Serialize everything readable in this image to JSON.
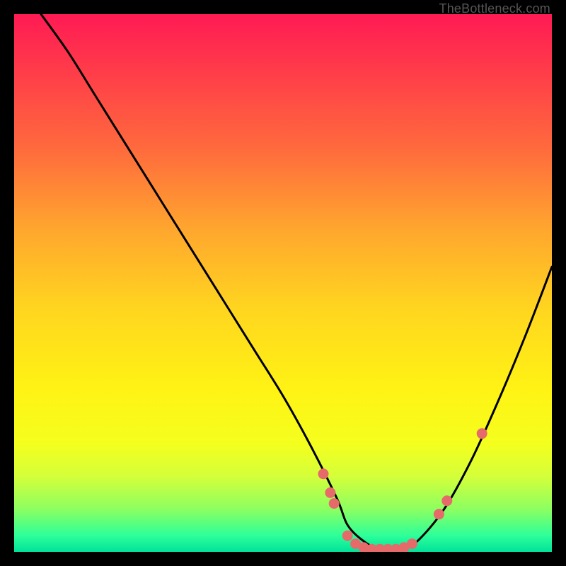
{
  "watermark": "TheBottleneck.com",
  "chart_data": {
    "type": "line",
    "title": "",
    "xlabel": "",
    "ylabel": "",
    "xlim": [
      0,
      100
    ],
    "ylim": [
      0,
      100
    ],
    "grid": false,
    "legend": false,
    "series": [
      {
        "name": "bottleneck-curve",
        "x": [
          5,
          10,
          15,
          20,
          25,
          30,
          35,
          40,
          45,
          50,
          55,
          60,
          62,
          65,
          68,
          72,
          75,
          80,
          85,
          90,
          95,
          100
        ],
        "y": [
          100,
          93,
          85,
          77,
          69,
          61,
          53,
          45,
          37,
          29,
          20,
          10,
          5,
          2,
          0.5,
          0.5,
          2,
          8,
          17,
          28,
          40,
          53
        ],
        "color": "#000000"
      }
    ],
    "markers": [
      {
        "x": 57.5,
        "y": 14.5
      },
      {
        "x": 58.8,
        "y": 11.0
      },
      {
        "x": 59.5,
        "y": 9.0
      },
      {
        "x": 62.0,
        "y": 3.0
      },
      {
        "x": 63.5,
        "y": 1.5
      },
      {
        "x": 65.0,
        "y": 0.8
      },
      {
        "x": 66.5,
        "y": 0.5
      },
      {
        "x": 68.0,
        "y": 0.5
      },
      {
        "x": 69.5,
        "y": 0.5
      },
      {
        "x": 71.0,
        "y": 0.5
      },
      {
        "x": 72.5,
        "y": 0.8
      },
      {
        "x": 74.0,
        "y": 1.5
      },
      {
        "x": 79.0,
        "y": 7.0
      },
      {
        "x": 80.5,
        "y": 9.5
      },
      {
        "x": 87.0,
        "y": 22.0
      }
    ],
    "marker_color": "#e76a6a",
    "gradient_stops": [
      {
        "pos": 0.0,
        "color": "#ff1a54"
      },
      {
        "pos": 0.1,
        "color": "#ff3a4a"
      },
      {
        "pos": 0.25,
        "color": "#ff6a3d"
      },
      {
        "pos": 0.4,
        "color": "#ffa62e"
      },
      {
        "pos": 0.55,
        "color": "#ffd61f"
      },
      {
        "pos": 0.7,
        "color": "#fff314"
      },
      {
        "pos": 0.8,
        "color": "#f4ff1e"
      },
      {
        "pos": 0.86,
        "color": "#d4ff3a"
      },
      {
        "pos": 0.92,
        "color": "#8dff60"
      },
      {
        "pos": 0.97,
        "color": "#2dff9a"
      },
      {
        "pos": 1.0,
        "color": "#00e29a"
      }
    ]
  }
}
